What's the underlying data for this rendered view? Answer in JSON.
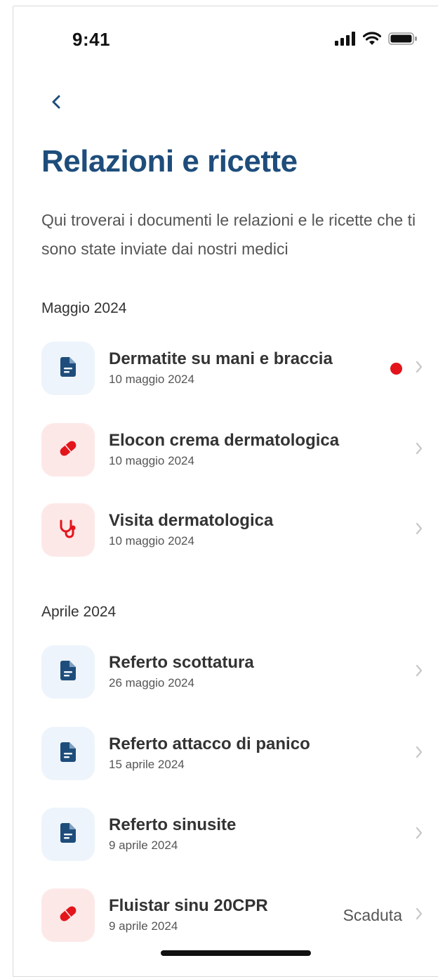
{
  "status_bar": {
    "time": "9:41"
  },
  "header": {
    "title": "Relazioni e ricette",
    "subtitle": "Qui troverai i documenti le relazioni e le ricette che ti sono state inviate dai nostri medici"
  },
  "sections": [
    {
      "label": "Maggio 2024",
      "items": [
        {
          "title": "Dermatite su mani e braccia",
          "date": "10 maggio 2024",
          "icon": "document-icon",
          "unread": true
        },
        {
          "title": "Elocon crema dermatologica",
          "date": "10 maggio 2024",
          "icon": "pill-icon"
        },
        {
          "title": "Visita dermatologica",
          "date": "10 maggio 2024",
          "icon": "stethoscope-icon"
        }
      ]
    },
    {
      "label": "Aprile 2024",
      "items": [
        {
          "title": "Referto scottatura",
          "date": "26 maggio 2024",
          "icon": "document-icon"
        },
        {
          "title": "Referto attacco di panico",
          "date": "15 aprile 2024",
          "icon": "document-icon"
        },
        {
          "title": "Referto sinusite",
          "date": "9 aprile 2024",
          "icon": "document-icon"
        },
        {
          "title": "Fluistar sinu 20CPR",
          "date": "9 aprile 2024",
          "icon": "pill-icon",
          "status": "Scaduta"
        }
      ]
    }
  ],
  "colors": {
    "title": "#1e4d7b",
    "document_icon": "#1e4d7b",
    "red_icon": "#e4141b",
    "unread_dot": "#e4141b"
  }
}
